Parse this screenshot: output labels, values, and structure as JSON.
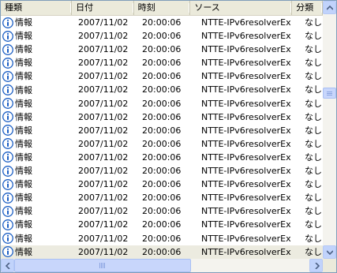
{
  "columns": [
    "種類",
    "日付",
    "時刻",
    "ソース",
    "分類"
  ],
  "rows": [
    {
      "type": "情報",
      "date": "2007/11/02",
      "time": "20:00:06",
      "source": "NTTE-IPv6resolverEx",
      "category": "なし"
    },
    {
      "type": "情報",
      "date": "2007/11/02",
      "time": "20:00:06",
      "source": "NTTE-IPv6resolverEx",
      "category": "なし"
    },
    {
      "type": "情報",
      "date": "2007/11/02",
      "time": "20:00:06",
      "source": "NTTE-IPv6resolverEx",
      "category": "なし"
    },
    {
      "type": "情報",
      "date": "2007/11/02",
      "time": "20:00:06",
      "source": "NTTE-IPv6resolverEx",
      "category": "なし"
    },
    {
      "type": "情報",
      "date": "2007/11/02",
      "time": "20:00:06",
      "source": "NTTE-IPv6resolverEx",
      "category": "なし"
    },
    {
      "type": "情報",
      "date": "2007/11/02",
      "time": "20:00:06",
      "source": "NTTE-IPv6resolverEx",
      "category": "なし"
    },
    {
      "type": "情報",
      "date": "2007/11/02",
      "time": "20:00:06",
      "source": "NTTE-IPv6resolverEx",
      "category": "なし"
    },
    {
      "type": "情報",
      "date": "2007/11/02",
      "time": "20:00:06",
      "source": "NTTE-IPv6resolverEx",
      "category": "なし"
    },
    {
      "type": "情報",
      "date": "2007/11/02",
      "time": "20:00:06",
      "source": "NTTE-IPv6resolverEx",
      "category": "なし"
    },
    {
      "type": "情報",
      "date": "2007/11/02",
      "time": "20:00:06",
      "source": "NTTE-IPv6resolverEx",
      "category": "なし"
    },
    {
      "type": "情報",
      "date": "2007/11/02",
      "time": "20:00:06",
      "source": "NTTE-IPv6resolverEx",
      "category": "なし"
    },
    {
      "type": "情報",
      "date": "2007/11/02",
      "time": "20:00:06",
      "source": "NTTE-IPv6resolverEx",
      "category": "なし"
    },
    {
      "type": "情報",
      "date": "2007/11/02",
      "time": "20:00:06",
      "source": "NTTE-IPv6resolverEx",
      "category": "なし"
    },
    {
      "type": "情報",
      "date": "2007/11/02",
      "time": "20:00:06",
      "source": "NTTE-IPv6resolverEx",
      "category": "なし"
    },
    {
      "type": "情報",
      "date": "2007/11/02",
      "time": "20:00:06",
      "source": "NTTE-IPv6resolverEx",
      "category": "なし"
    },
    {
      "type": "情報",
      "date": "2007/11/02",
      "time": "20:00:06",
      "source": "NTTE-IPv6resolverEx",
      "category": "なし"
    },
    {
      "type": "情報",
      "date": "2007/11/02",
      "time": "20:00:06",
      "source": "NTTE-IPv6resolverEx",
      "category": "なし"
    },
    {
      "type": "情報",
      "date": "2007/11/02",
      "time": "20:00:06",
      "source": "NTTE-IPv6resolverEx",
      "category": "なし"
    }
  ],
  "selected_row": 17,
  "row_icon": "info-icon",
  "colors": {
    "header_bg": "#ebeadb",
    "selected_bg": "#ecebe0",
    "icon_blue": "#1c5fc4",
    "scroll_blue": "#c1d3fb"
  }
}
